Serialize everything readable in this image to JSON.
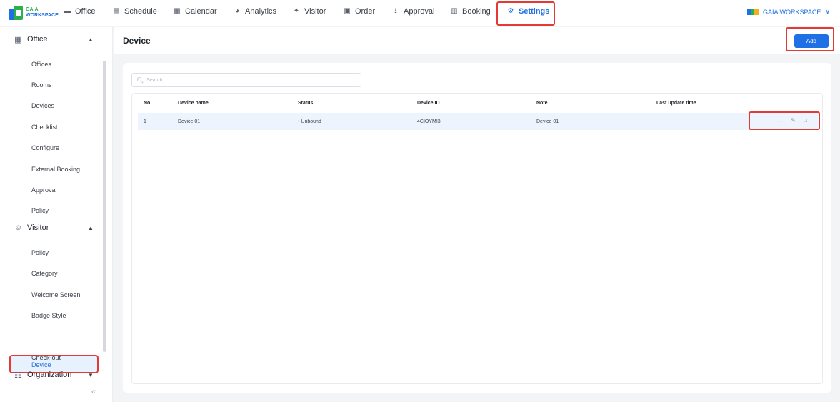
{
  "brand": {
    "line1": "GAIA",
    "line2": "WORKSPACE"
  },
  "nav": [
    {
      "key": "office",
      "label": "Office",
      "icon": "office-icon",
      "glyph": "▬"
    },
    {
      "key": "schedule",
      "label": "Schedule",
      "icon": "schedule-icon",
      "glyph": "▤"
    },
    {
      "key": "calendar",
      "label": "Calendar",
      "icon": "calendar-icon",
      "glyph": "▦"
    },
    {
      "key": "analytics",
      "label": "Analytics",
      "icon": "analytics-icon",
      "glyph": "◕"
    },
    {
      "key": "visitor",
      "label": "Visitor",
      "icon": "visitor-icon",
      "glyph": "✦"
    },
    {
      "key": "order",
      "label": "Order",
      "icon": "order-icon",
      "glyph": "▣"
    },
    {
      "key": "approval",
      "label": "Approval",
      "icon": "approval-icon",
      "glyph": "⭳"
    },
    {
      "key": "booking",
      "label": "Booking",
      "icon": "booking-icon",
      "glyph": "▥"
    },
    {
      "key": "settings",
      "label": "Settings",
      "icon": "gear-icon",
      "glyph": "⚙",
      "active": true
    }
  ],
  "workspace": {
    "label": "GAIA WORKSPACE"
  },
  "sidebar": {
    "groups": [
      {
        "label": "Office",
        "items": [
          "Offices",
          "Rooms",
          "Devices",
          "Checklist",
          "Configure",
          "External Booking",
          "Approval",
          "Policy"
        ]
      },
      {
        "label": "Visitor",
        "items": [
          "Policy",
          "Category",
          "Welcome Screen",
          "Badge Style",
          "Device",
          "Check-out"
        ]
      },
      {
        "label": "Organization",
        "items": []
      }
    ],
    "active_item": "Device",
    "collapse_glyph": "«"
  },
  "page": {
    "title": "Device",
    "add_label": "Add"
  },
  "search": {
    "placeholder": "Search"
  },
  "table": {
    "headers": [
      "No.",
      "Device name",
      "Status",
      "Device ID",
      "Note",
      "Last update time"
    ],
    "rows": [
      {
        "no": "1",
        "name": "Device 01",
        "status": "Unbound",
        "device_id": "4CIOYMI3",
        "note": "Device 01",
        "updated": ""
      }
    ]
  },
  "colors": {
    "accent": "#1f6fe5",
    "highlight": "#e53935",
    "row_bg": "#eef4fd"
  }
}
